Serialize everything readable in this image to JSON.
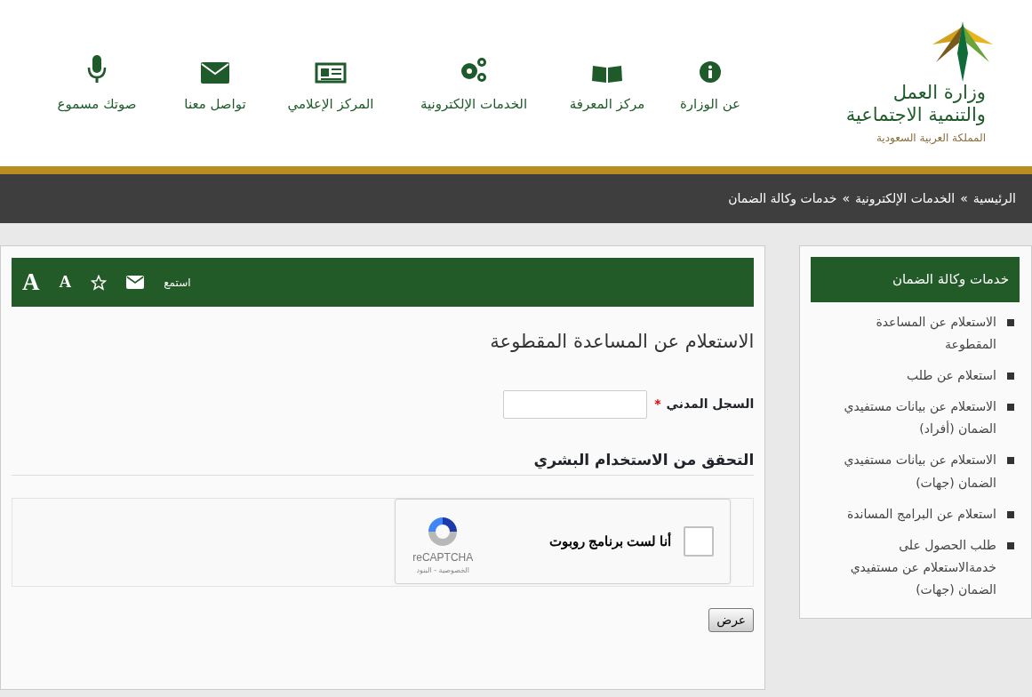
{
  "logo": {
    "line_1": "وزارة العمل",
    "line_2": "والتنمية الاجتماعية",
    "line_3": "المملكة العربية السعودية"
  },
  "nav": [
    {
      "label": "عن الوزارة"
    },
    {
      "label": "مركز المعرفة"
    },
    {
      "label": "الخدمات الإلكترونية"
    },
    {
      "label": "المركز الإعلامي"
    },
    {
      "label": "تواصل معنا"
    },
    {
      "label": "صوتك مسموع"
    }
  ],
  "breadcrumb": {
    "separator": "»",
    "items": [
      "الرئيسية",
      "الخدمات الإلكترونية",
      "خدمات وكالة الضمان"
    ]
  },
  "sidebar": {
    "title": "خدمات وكالة الضمان",
    "items": [
      "الاستعلام عن المساعدة المقطوعة",
      "استعلام عن طلب",
      "الاستعلام عن بيانات مستفيدي الضمان (أفراد)",
      "الاستعلام عن بيانات مستفيدي الضمان (جهات)",
      "استعلام عن البرامج المساندة",
      "طلب الحصول على خدمةالاستعلام عن مستفيدي الضمان (جهات)"
    ]
  },
  "toolbar": {
    "listen": "استمع",
    "font_small": "A",
    "font_large": "A"
  },
  "page_title": "الاستعلام عن المساعدة المقطوعة",
  "form": {
    "label": "السجل المدني",
    "required_mark": "*"
  },
  "captcha": {
    "heading": "التحقق من الاستخدام البشري",
    "label": "أنا لست برنامج روبوت",
    "checked": false,
    "brand": "reCAPTCHA",
    "terms": "الخصوصية - البنود"
  },
  "submit": "عرض"
}
